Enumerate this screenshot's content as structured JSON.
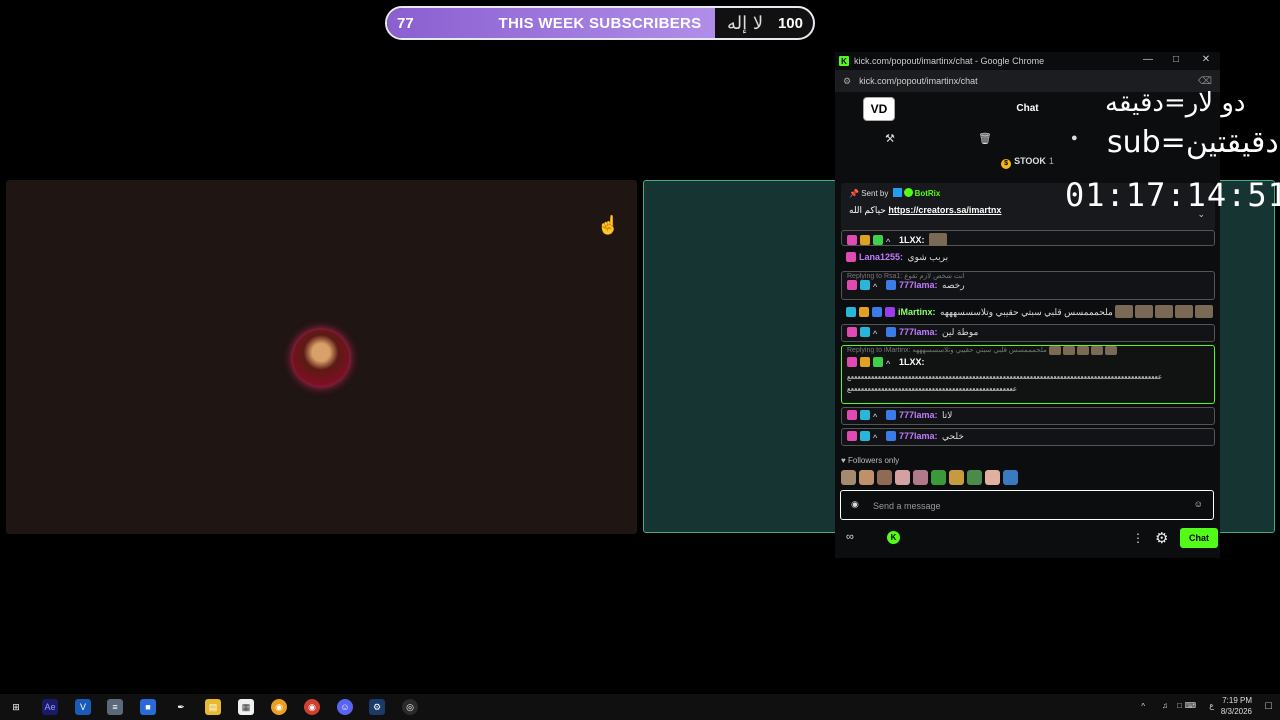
{
  "goal": {
    "start": "77",
    "title": "THIS WEEK SUBSCRIBERS",
    "arabic": "لا إله",
    "end": "100",
    "progress_fraction": 0.77
  },
  "overlay": {
    "line1": "دو لار=دقيقه",
    "line2": "sub=دقيقتين",
    "timer": "01:17:14:51"
  },
  "browser": {
    "window_title": "kick.com/popout/imartinx/chat - Google Chrome",
    "url": "kick.com/popout/imartinx/chat"
  },
  "chat": {
    "header": {
      "logo": "VD",
      "title": "Chat"
    },
    "stook": {
      "label": "STOOK",
      "count": "1"
    },
    "pinned": {
      "sent_by": "Sent by",
      "bot": "BotRix",
      "prefix": "حياكم الله",
      "link": "https://creators.sa/imartnx"
    },
    "messages": [
      {
        "user": "1LXX:",
        "text": ""
      },
      {
        "user": "Lana1255:",
        "text": "بربب شوي"
      },
      {
        "reply": "Replying to Rsa1: انت شخص لازم تقوع",
        "user": "777lama:",
        "text": "رخصه"
      },
      {
        "user": "iMartinx:",
        "text": "ملحمممسس قلبي سبتي حقيبي وتلاسسسهههه"
      },
      {
        "user": "777lama:",
        "text": "موطة لين"
      },
      {
        "reply": "Replying to iMartinx: ملحمممسس قلبي سبتي حقيبي وتلاسسسهههه",
        "user": "1LXX:",
        "text": "ععععععععععععععععععععععععععععععععععععععععععععععععععععععععععععععععععععععععععععععععععععععععععععع",
        "text2": "عععععععععععععععععععععععععععععععععععععععععععععععععع"
      },
      {
        "user": "777lama:",
        "text": "لاتا"
      },
      {
        "user": "777lama:",
        "text": "خلحي"
      }
    ],
    "followers_label": "Followers only",
    "send_placeholder": "Send a message",
    "chat_button": "Chat"
  },
  "taskbar": {
    "time": "7:19 PM",
    "date": "8/3/2026",
    "lang": "ع"
  }
}
